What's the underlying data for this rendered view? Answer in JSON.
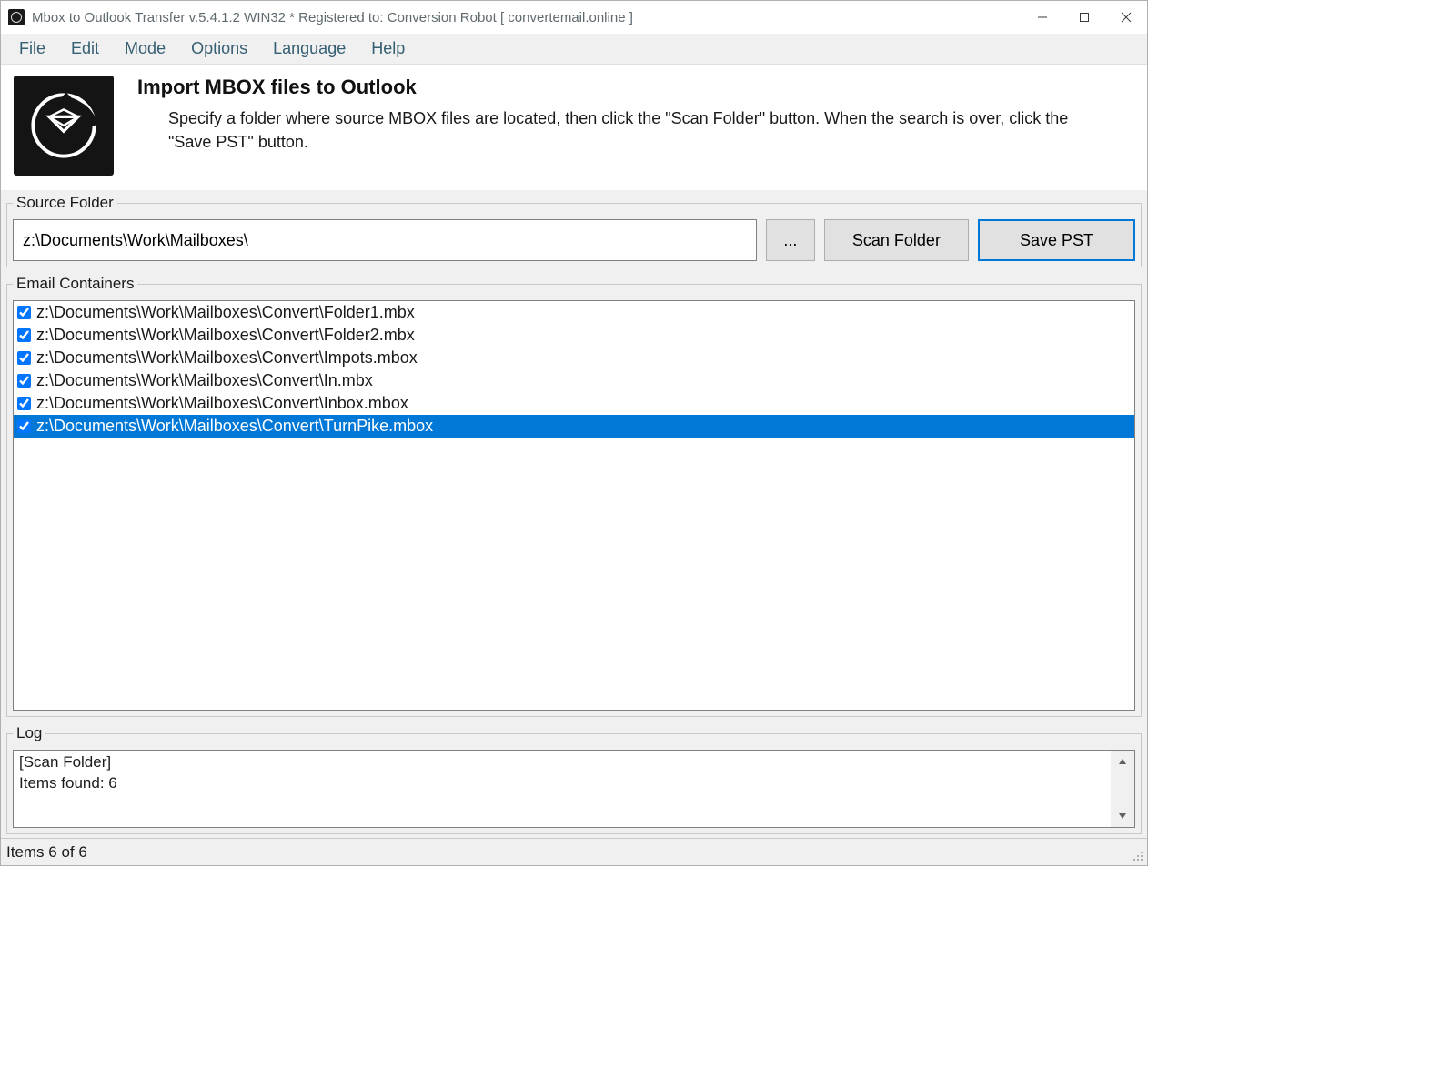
{
  "window": {
    "title": "Mbox to Outlook Transfer v.5.4.1.2 WIN32 * Registered to: Conversion Robot [ convertemail.online ]"
  },
  "menu": {
    "items": [
      "File",
      "Edit",
      "Mode",
      "Options",
      "Language",
      "Help"
    ]
  },
  "header": {
    "title": "Import MBOX files to Outlook",
    "description": "Specify a folder where source MBOX files are located, then click the \"Scan Folder\" button. When the search is over, click the \"Save PST\" button."
  },
  "source": {
    "legend": "Source Folder",
    "value": "z:\\Documents\\Work\\Mailboxes\\",
    "browse_label": "...",
    "scan_label": "Scan Folder",
    "save_label": "Save PST"
  },
  "containers": {
    "legend": "Email Containers",
    "items": [
      {
        "checked": true,
        "selected": false,
        "path": "z:\\Documents\\Work\\Mailboxes\\Convert\\Folder1.mbx"
      },
      {
        "checked": true,
        "selected": false,
        "path": "z:\\Documents\\Work\\Mailboxes\\Convert\\Folder2.mbx"
      },
      {
        "checked": true,
        "selected": false,
        "path": "z:\\Documents\\Work\\Mailboxes\\Convert\\Impots.mbox"
      },
      {
        "checked": true,
        "selected": false,
        "path": "z:\\Documents\\Work\\Mailboxes\\Convert\\In.mbx"
      },
      {
        "checked": true,
        "selected": false,
        "path": "z:\\Documents\\Work\\Mailboxes\\Convert\\Inbox.mbox"
      },
      {
        "checked": true,
        "selected": true,
        "path": "z:\\Documents\\Work\\Mailboxes\\Convert\\TurnPike.mbox"
      }
    ]
  },
  "log": {
    "legend": "Log",
    "text": "[Scan Folder]\nItems found: 6"
  },
  "status": {
    "text": "Items 6 of 6"
  }
}
